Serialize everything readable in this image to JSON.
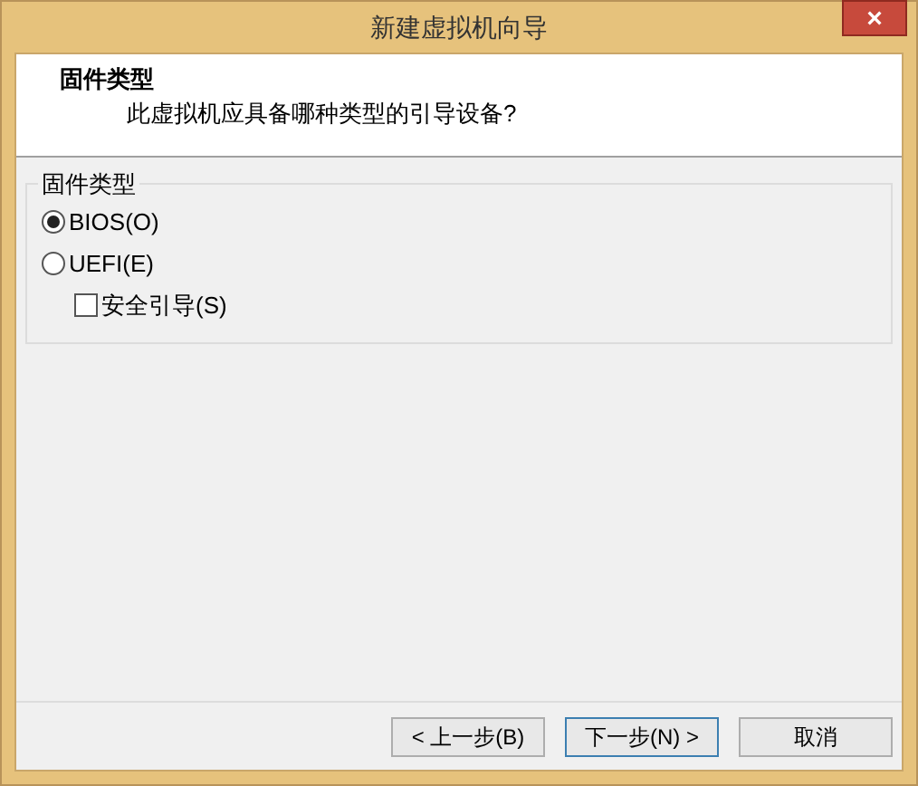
{
  "window": {
    "title": "新建虚拟机向导",
    "close": "×"
  },
  "header": {
    "title": "固件类型",
    "subtitle": "此虚拟机应具备哪种类型的引导设备?"
  },
  "group": {
    "title": "固件类型",
    "options": [
      {
        "kind": "radio",
        "label": "BIOS(O)",
        "selected": true
      },
      {
        "kind": "radio",
        "label": "UEFI(E)",
        "selected": false
      },
      {
        "kind": "checkbox",
        "label": "安全引导(S)",
        "checked": false
      }
    ]
  },
  "buttons": [
    {
      "label": "< 上一步(B)",
      "default": false
    },
    {
      "label": "下一步(N) >",
      "default": true
    },
    {
      "label": "取消",
      "default": false
    }
  ]
}
